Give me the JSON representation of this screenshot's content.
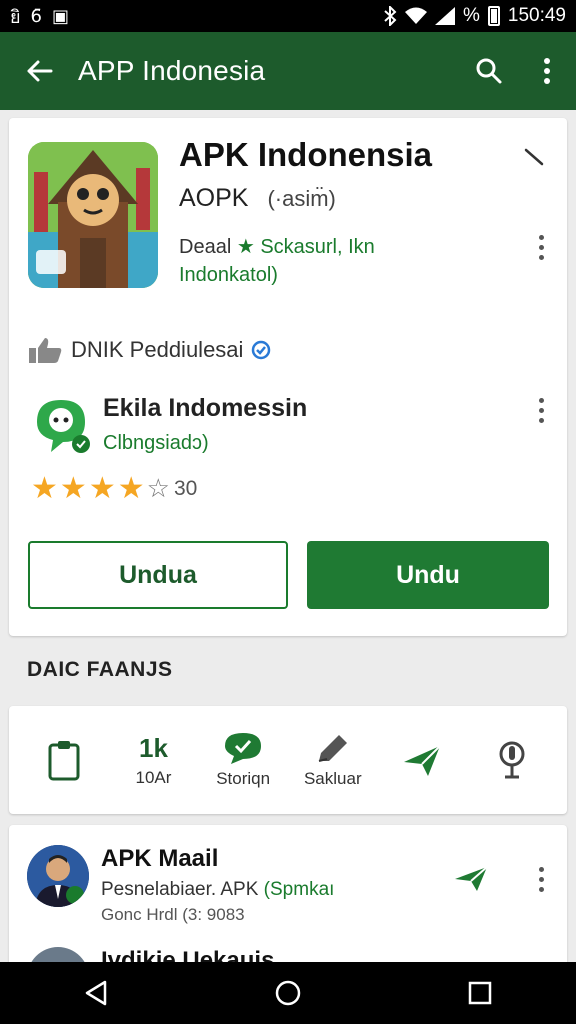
{
  "status_bar": {
    "left_icons": [
      "signal-alt-icon",
      "sim-icon",
      "image-icon"
    ],
    "left_glyphs": [
      "ยิ",
      "6̄",
      "▣"
    ],
    "time": "150:49",
    "percent_symbol": "%"
  },
  "app_bar": {
    "title": "APP Indonesia",
    "background": "#1d5b2c"
  },
  "app": {
    "title": "APK Indonensia",
    "subtitle": "AOPK",
    "subtitle_paren": "(·asim̈)",
    "developer_prefix": "Deaal",
    "developer_highlight": "★ Sckasurl, Ikn",
    "developer_line2": "Indonkatol)"
  },
  "recommendation": {
    "text": "DNIK Peddiulesai"
  },
  "sub_app": {
    "title": "Ekila Indomessin",
    "category": "Clbngsiadɔ)",
    "rating": 4,
    "rating_max": 5,
    "rating_count": "30"
  },
  "buttons": {
    "secondary_label": "Undua",
    "primary_label": "Undu"
  },
  "section": {
    "label": "DAIC FAANJS"
  },
  "icon_row": [
    {
      "icon": "clipboard-icon",
      "big": "",
      "label": ""
    },
    {
      "icon": "count",
      "big": "1k",
      "label": "10Ar"
    },
    {
      "icon": "chat-bubble-icon",
      "big": "",
      "label": "Storiqn"
    },
    {
      "icon": "pencil-icon",
      "big": "",
      "label": "Sakluar"
    },
    {
      "icon": "send-icon",
      "big": "",
      "label": ""
    },
    {
      "icon": "microphone-icon",
      "big": "",
      "label": ""
    }
  ],
  "list": [
    {
      "title": "APK Maail",
      "subtitle_prefix": "Pesnelabiaer. APK",
      "subtitle_highlight": "(Spmkaı",
      "meta": "Gonc Hrdl (3: 9083"
    },
    {
      "title": "Ivdikie Uekaujs",
      "subtitle_prefix": "",
      "subtitle_highlight": "",
      "meta": ""
    }
  ],
  "colors": {
    "accent": "#1a7b2d",
    "star": "#f5a623"
  }
}
